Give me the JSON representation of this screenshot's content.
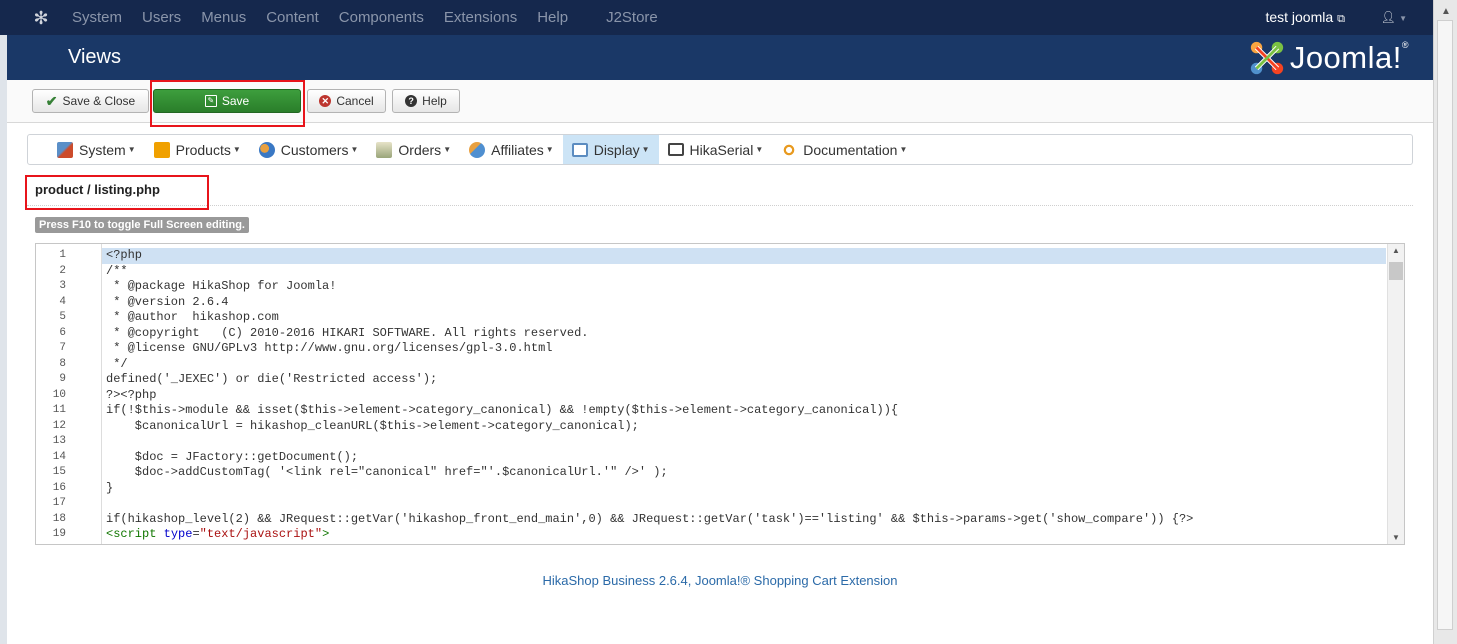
{
  "topbar": {
    "menu": [
      {
        "label": "System"
      },
      {
        "label": "Users"
      },
      {
        "label": "Menus"
      },
      {
        "label": "Content"
      },
      {
        "label": "Components"
      },
      {
        "label": "Extensions"
      },
      {
        "label": "Help"
      }
    ],
    "active_menu": "J2Store",
    "user_label": "test joomla",
    "icons": [
      "joomla-logo-icon",
      "external-link-icon",
      "user-icon",
      "caret-down-icon"
    ]
  },
  "header": {
    "title": "Views",
    "brand": "Joomla!",
    "brand_reg": "®"
  },
  "toolbar": {
    "save_close_label": "Save & Close",
    "save_label": "Save",
    "cancel_label": "Cancel",
    "help_label": "Help"
  },
  "submenu": {
    "items": [
      {
        "label": "System",
        "icon": "tools-icon",
        "color": "#3f7fbf"
      },
      {
        "label": "Products",
        "icon": "products-icon",
        "color": "#f0a000"
      },
      {
        "label": "Customers",
        "icon": "customers-icon",
        "color": "#3a78c4"
      },
      {
        "label": "Orders",
        "icon": "orders-icon",
        "color": "#8a9a6a"
      },
      {
        "label": "Affiliates",
        "icon": "affiliates-icon",
        "color": "#4f8fd0"
      },
      {
        "label": "Display",
        "icon": "display-icon",
        "color": "#5b8cc0"
      },
      {
        "label": "HikaSerial",
        "icon": "hikaserial-icon",
        "color": "#444444"
      },
      {
        "label": "Documentation",
        "icon": "documentation-icon",
        "color": "#e89a20"
      }
    ],
    "active": "Display"
  },
  "file": {
    "title": "product / listing.php",
    "hint": "Press F10 to toggle Full Screen editing."
  },
  "editor": {
    "lines": [
      "<?php",
      "/**",
      " * @package HikaShop for Joomla!",
      " * @version 2.6.4",
      " * @author  hikashop.com",
      " * @copyright   (C) 2010-2016 HIKARI SOFTWARE. All rights reserved.",
      " * @license GNU/GPLv3 http://www.gnu.org/licenses/gpl-3.0.html",
      " */",
      "defined('_JEXEC') or die('Restricted access');",
      "?><?php",
      "if(!$this->module && isset($this->element->category_canonical) && !empty($this->element->category_canonical)){",
      "    $canonicalUrl = hikashop_cleanURL($this->element->category_canonical);",
      "",
      "    $doc = JFactory::getDocument();",
      "    $doc->addCustomTag( '<link rel=\"canonical\" href=\"'.$canonicalUrl.'\" />' );",
      "}",
      "",
      "if(hikashop_level(2) && JRequest::getVar('hikashop_front_end_main',0) && JRequest::getVar('task')=='listing' && $this->params->get('show_compare')) {?>",
      "<script type=\"text/javascript\">"
    ],
    "line_numbers": [
      "1",
      "2",
      "3",
      "4",
      "5",
      "6",
      "7",
      "8",
      "9",
      "10",
      "11",
      "12",
      "13",
      "14",
      "15",
      "16",
      "17",
      "18",
      "19"
    ]
  },
  "footer": {
    "text": "HikaShop Business 2.6.4, Joomla!® Shopping Cart Extension"
  }
}
